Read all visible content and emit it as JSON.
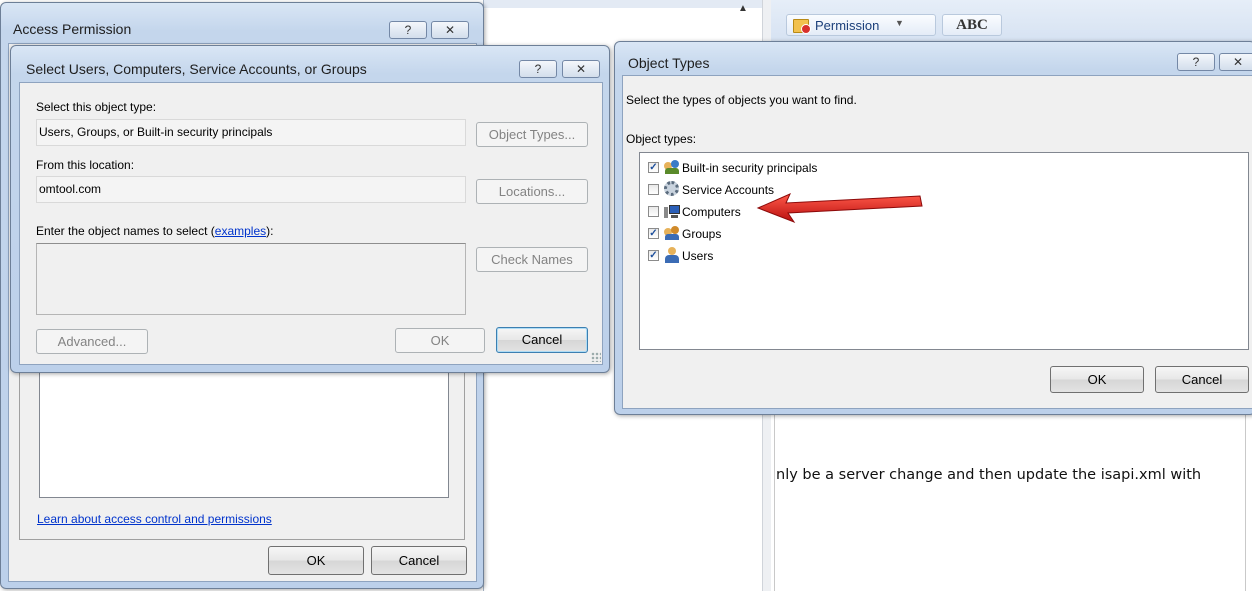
{
  "access_permission": {
    "title": "Access Permission",
    "help_glyph": "?",
    "close_glyph": "✕",
    "learn_link": "Learn about access control and permissions",
    "ok_label": "OK",
    "cancel_label": "Cancel"
  },
  "select_users": {
    "title": "Select Users, Computers, Service Accounts, or Groups",
    "help_glyph": "?",
    "close_glyph": "✕",
    "object_type_label": "Select this object type:",
    "object_type_value": "Users, Groups, or Built-in security principals",
    "object_types_button": "Object Types...",
    "location_label": "From this location:",
    "location_value": "omtool.com",
    "locations_button": "Locations...",
    "enter_names_prefix": "Enter the object names to select (",
    "enter_names_link": "examples",
    "enter_names_suffix": "):",
    "names_value": "",
    "check_names_button": "Check Names",
    "advanced_button": "Advanced...",
    "ok_label": "OK",
    "cancel_label": "Cancel"
  },
  "object_types": {
    "title": "Object Types",
    "help_glyph": "?",
    "close_glyph": "✕",
    "instruction": "Select the types of objects you want to find.",
    "list_label": "Object types:",
    "items": [
      {
        "label": "Built-in security principals",
        "checked": true,
        "icon": "security-principals-icon"
      },
      {
        "label": "Service Accounts",
        "checked": false,
        "icon": "service-accounts-icon"
      },
      {
        "label": "Computers",
        "checked": false,
        "icon": "computer-icon"
      },
      {
        "label": "Groups",
        "checked": true,
        "icon": "groups-icon"
      },
      {
        "label": "Users",
        "checked": true,
        "icon": "user-icon"
      }
    ],
    "ok_label": "OK",
    "cancel_label": "Cancel"
  },
  "background_doc": {
    "permission_button": "Permission",
    "spell_button": "ABC",
    "body_text": "nly be a server change and then update the isapi.xml with"
  },
  "colors": {
    "annotation_arrow": "#e11b1b",
    "link": "#0033cc",
    "window_frame": "#bcd0ea"
  }
}
